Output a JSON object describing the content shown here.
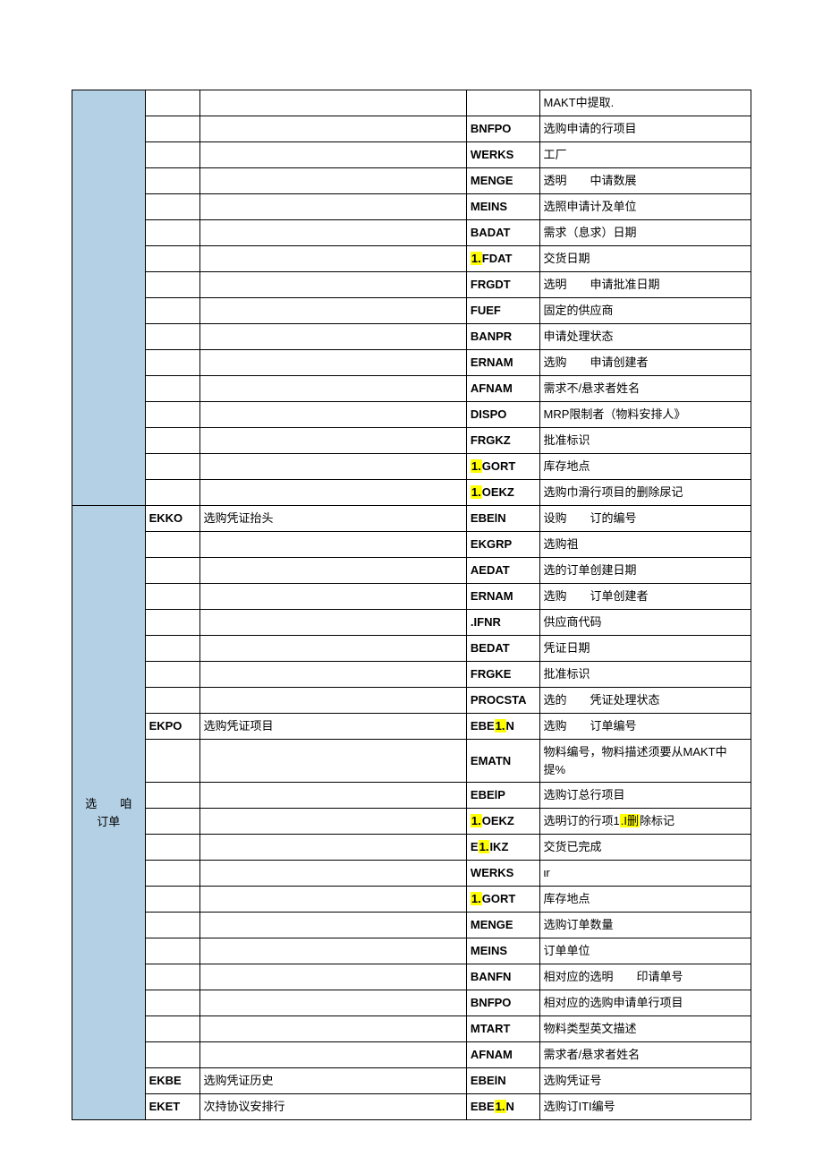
{
  "sections": [
    {
      "category": "",
      "rows": [
        {
          "tbl": "",
          "tbldesc": "",
          "fld": "",
          "fdesc": "MAKT中提取."
        },
        {
          "tbl": "",
          "tbldesc": "",
          "fld": "BNFPO",
          "fdesc": "选购申请的行项目"
        },
        {
          "tbl": "",
          "tbldesc": "",
          "fld": "WERKS",
          "fdesc": "工厂"
        },
        {
          "tbl": "",
          "tbldesc": "",
          "fld": "MENGE",
          "fdesc": "透明　　中请数展"
        },
        {
          "tbl": "",
          "tbldesc": "",
          "fld": "MEINS",
          "fdesc": "选照申请计及单位"
        },
        {
          "tbl": "",
          "tbldesc": "",
          "fld": "BADAT",
          "fdesc": "需求（息求）日期"
        },
        {
          "tbl": "",
          "tbldesc": "",
          "fld": "1.FDAT",
          "hl": [
            0,
            2
          ],
          "fdesc": "交货日期"
        },
        {
          "tbl": "",
          "tbldesc": "",
          "fld": "FRGDT",
          "fdesc": "选明　　申请批准日期"
        },
        {
          "tbl": "",
          "tbldesc": "",
          "fld": "FUEF",
          "fdesc": "固定的供应商"
        },
        {
          "tbl": "",
          "tbldesc": "",
          "fld": "BANPR",
          "fdesc": "申请处理状态"
        },
        {
          "tbl": "",
          "tbldesc": "",
          "fld": "ERNAM",
          "fdesc": "选购　　申请创建者"
        },
        {
          "tbl": "",
          "tbldesc": "",
          "fld": "AFNAM",
          "fdesc": "需求不/悬求者姓名"
        },
        {
          "tbl": "",
          "tbldesc": "",
          "fld": "DISPO",
          "fdesc": "MRP限制者（物料安排人》"
        },
        {
          "tbl": "",
          "tbldesc": "",
          "fld": "FRGKZ",
          "fdesc": "批准标识"
        },
        {
          "tbl": "",
          "tbldesc": "",
          "fld": "1.GORT",
          "hl": [
            0,
            2
          ],
          "fdesc": "库存地点"
        },
        {
          "tbl": "",
          "tbldesc": "",
          "fld": "1.OEKZ",
          "hl": [
            0,
            2
          ],
          "fdesc": "选购巾滑行项目的删除尿记"
        }
      ]
    },
    {
      "category": "选　　咱　　订单",
      "rows": [
        {
          "tbl": "EKKO",
          "tbldesc": "选购凭证抬头",
          "fld": "EBElN",
          "fdesc": "设购　　订的编号"
        },
        {
          "tbl": "",
          "tbldesc": "",
          "fld": "EKGRP",
          "fdesc": "选购祖"
        },
        {
          "tbl": "",
          "tbldesc": "",
          "fld": "AEDAT",
          "fdesc": "选的订单创建日期"
        },
        {
          "tbl": "",
          "tbldesc": "",
          "fld": "ERNAM",
          "fdesc": "选购　　订单创建者"
        },
        {
          "tbl": "",
          "tbldesc": "",
          "fld": ".IFNR",
          "fdesc": "供应商代码"
        },
        {
          "tbl": "",
          "tbldesc": "",
          "fld": "BEDAT",
          "fdesc": "凭证日期"
        },
        {
          "tbl": "",
          "tbldesc": "",
          "fld": "FRGKE",
          "fdesc": "批准标识"
        },
        {
          "tbl": "",
          "tbldesc": "",
          "fld": "PROCSTA",
          "fdesc": "选的　　凭证处理状态"
        },
        {
          "tbl": "EKPO",
          "tbldesc": "选购凭证项目",
          "fld": "EBE1.N",
          "hl": [
            3,
            5
          ],
          "fdesc": "选购　　订单编号"
        },
        {
          "tbl": "",
          "tbldesc": "",
          "fld": "EMATN",
          "fdesc": "物料编号，物料描述须要从MAKT中提%"
        },
        {
          "tbl": "",
          "tbldesc": "",
          "fld": "EBElP",
          "fdesc": "选购订总行项目"
        },
        {
          "tbl": "",
          "tbldesc": "",
          "fld": "1.OEKZ",
          "hl": [
            0,
            2
          ],
          "fdesc": "选明订的行项1.I删除标记",
          "fdeschl": [
            7,
            10
          ]
        },
        {
          "tbl": "",
          "tbldesc": "",
          "fld": "E1.IKZ",
          "hl": [
            1,
            3
          ],
          "fdesc": "交货已完成"
        },
        {
          "tbl": "",
          "tbldesc": "",
          "fld": "WERKS",
          "fdesc": "ιr"
        },
        {
          "tbl": "",
          "tbldesc": "",
          "fld": "1.GORT",
          "hl": [
            0,
            2
          ],
          "fdesc": "库存地点"
        },
        {
          "tbl": "",
          "tbldesc": "",
          "fld": "MENGE",
          "fdesc": "选购订单数量"
        },
        {
          "tbl": "",
          "tbldesc": "",
          "fld": "MEINS",
          "fdesc": "订单单位"
        },
        {
          "tbl": "",
          "tbldesc": "",
          "fld": "BANFN",
          "fdesc": "相对应的选明　　印请单号"
        },
        {
          "tbl": "",
          "tbldesc": "",
          "fld": "BNFPO",
          "fdesc": "相对应的选购申请单行项目"
        },
        {
          "tbl": "",
          "tbldesc": "",
          "fld": "MTART",
          "fdesc": "物料类型英文描述"
        },
        {
          "tbl": "",
          "tbldesc": "",
          "fld": "AFNAM",
          "fdesc": "需求者/悬求者姓名"
        },
        {
          "tbl": "EKBE",
          "tbldesc": "选购凭证历史",
          "fld": "EBElN",
          "fdesc": "选购凭证号"
        },
        {
          "tbl": "EKET",
          "tbldesc": "次持协议安排行",
          "fld": "EBE1.N",
          "hl": [
            3,
            5
          ],
          "fdesc": "选购订ITI编号"
        }
      ]
    }
  ]
}
